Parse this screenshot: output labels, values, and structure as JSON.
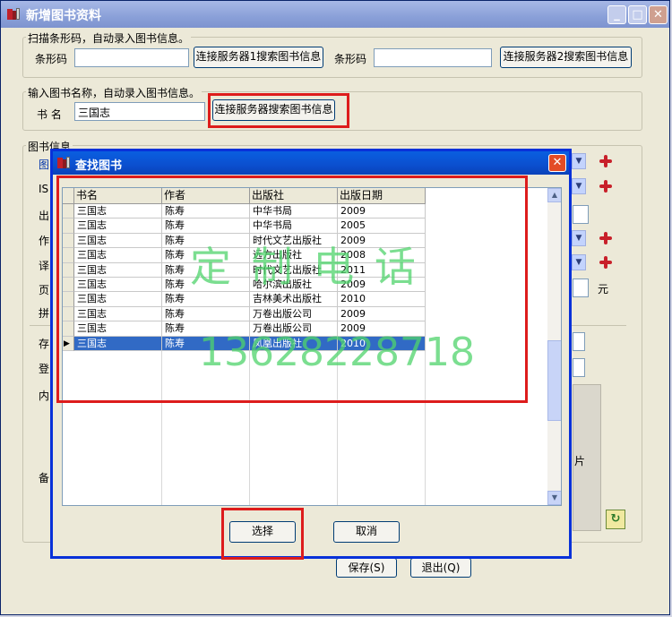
{
  "main_window": {
    "title": "新增图书资料",
    "scan_group": {
      "legend": "扫描条形码，自动录入图书信息。",
      "barcode_label_1": "条形码",
      "barcode_value_1": "",
      "search_button_1": "连接服务器1搜索图书信息",
      "barcode_label_2": "条形码",
      "barcode_value_2": "",
      "search_button_2": "连接服务器2搜索图书信息"
    },
    "name_group": {
      "legend": "输入图书名称，自动录入图书信息。",
      "book_name_label": "书 名",
      "book_name_value": "三国志",
      "search_button": "连接服务器搜索图书信息"
    },
    "info_group": {
      "legend": "图书信息",
      "partial_labels": [
        "图",
        "IS",
        "出",
        "作",
        "译",
        "页",
        "拼",
        "存",
        "登",
        "内",
        "备"
      ],
      "price_unit": "元",
      "photo_label_fragment": "片"
    },
    "save_button": "保存(S)",
    "exit_button": "退出(Q)"
  },
  "dialog": {
    "title": "查找图书",
    "columns": [
      "书名",
      "作者",
      "出版社",
      "出版日期"
    ],
    "rows": [
      [
        "三国志",
        "陈寿",
        "中华书局",
        "2009"
      ],
      [
        "三国志",
        "陈寿",
        "中华书局",
        "2005"
      ],
      [
        "三国志",
        "陈寿",
        "时代文艺出版社",
        "2009"
      ],
      [
        "三国志",
        "陈寿",
        "远方出版社",
        "2008"
      ],
      [
        "三国志",
        "陈寿",
        "时代文艺出版社",
        "2011"
      ],
      [
        "三国志",
        "陈寿",
        "哈尔滨出版社",
        "2009"
      ],
      [
        "三国志",
        "陈寿",
        "吉林美术出版社",
        "2010"
      ],
      [
        "三国志",
        "陈寿",
        "万卷出版公司",
        "2009"
      ],
      [
        "三国志",
        "陈寿",
        "万卷出版公司",
        "2009"
      ],
      [
        "三国志",
        "陈寿",
        "凤凰出版社",
        "2010"
      ]
    ],
    "selected_row": 9,
    "select_button": "选择",
    "cancel_button": "取消"
  },
  "watermark": {
    "line1": "定 制 电 话",
    "line2": "13628228718"
  },
  "colors": {
    "highlight": "#dd1c1c",
    "selection": "#316ac5",
    "watermark": "#4fd46c",
    "dialog_title": "#0a4fcf"
  }
}
